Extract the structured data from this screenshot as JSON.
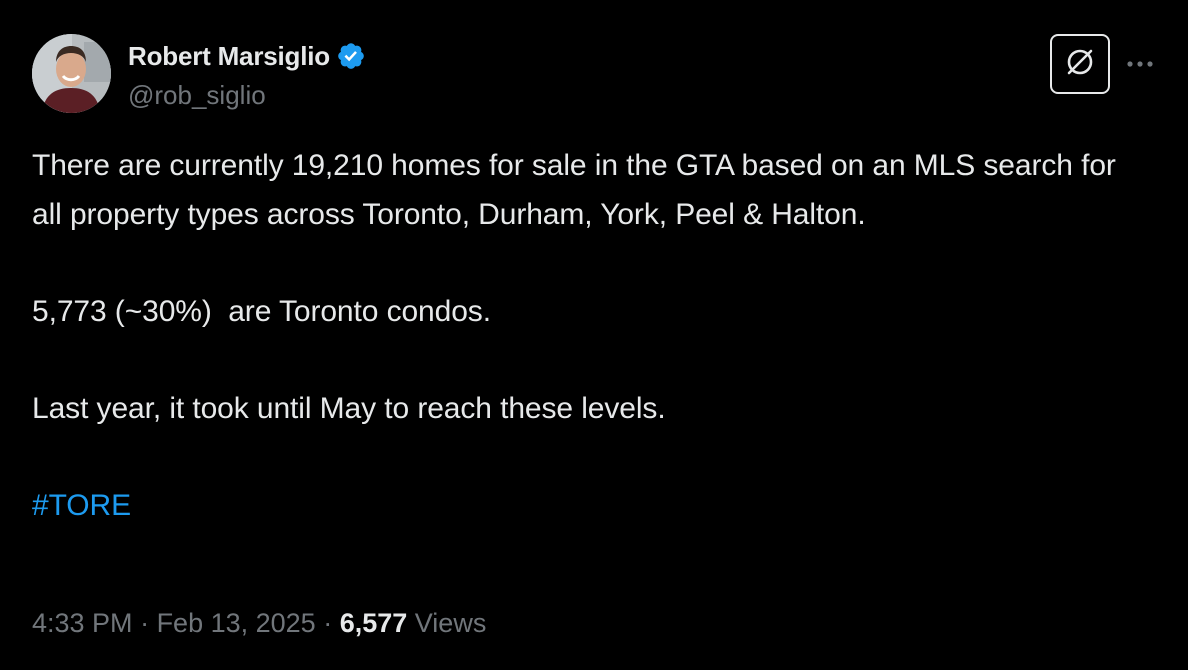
{
  "author": {
    "display_name": "Robert Marsiglio",
    "handle": "@rob_siglio",
    "verified_icon": "verified-badge-icon",
    "verified_color": "#1d9bf0"
  },
  "header_actions": {
    "grok_icon": "grok-icon",
    "more_icon": "more-dots-icon"
  },
  "tweet": {
    "lines": [
      "There are currently 19,210 homes for sale in the GTA based on an MLS search for all property types across Toronto, Durham, York, Peel & Halton.",
      "5,773 (~30%)  are Toronto condos.",
      "Last year, it took until May to reach these levels."
    ],
    "hashtag": "#TORE"
  },
  "meta": {
    "time": "4:33 PM",
    "separator": " · ",
    "date": "Feb 13, 2025",
    "views_count": "6,577",
    "views_label": " Views"
  },
  "colors": {
    "background": "#000000",
    "text": "#e7e9ea",
    "muted": "#71767b",
    "link": "#1d9bf0"
  }
}
